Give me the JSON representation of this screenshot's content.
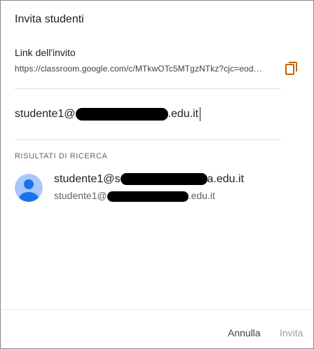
{
  "dialog": {
    "title": "Invita studenti"
  },
  "invite_link": {
    "label": "Link dell'invito",
    "url": "https://classroom.google.com/c/MTkwOTc5MTgzNTkz?cjc=eod…",
    "copy_icon": "copy-icon"
  },
  "search": {
    "value_prefix": "studente1@",
    "value_suffix": ".edu.it"
  },
  "results": {
    "section_label": "RISULTATI DI RICERCA",
    "items": [
      {
        "name_prefix": "studente1@s",
        "name_suffix": "a.edu.it",
        "email_prefix": "studente1@",
        "email_suffix": ".edu.it",
        "avatar_icon": "person-avatar-icon"
      }
    ]
  },
  "footer": {
    "cancel_label": "Annulla",
    "invite_label": "Invita"
  },
  "colors": {
    "accent": "#c26401",
    "avatar_bg": "#a8c7fa",
    "avatar_fg": "#1a73e8",
    "disabled": "#9aa0a6"
  }
}
